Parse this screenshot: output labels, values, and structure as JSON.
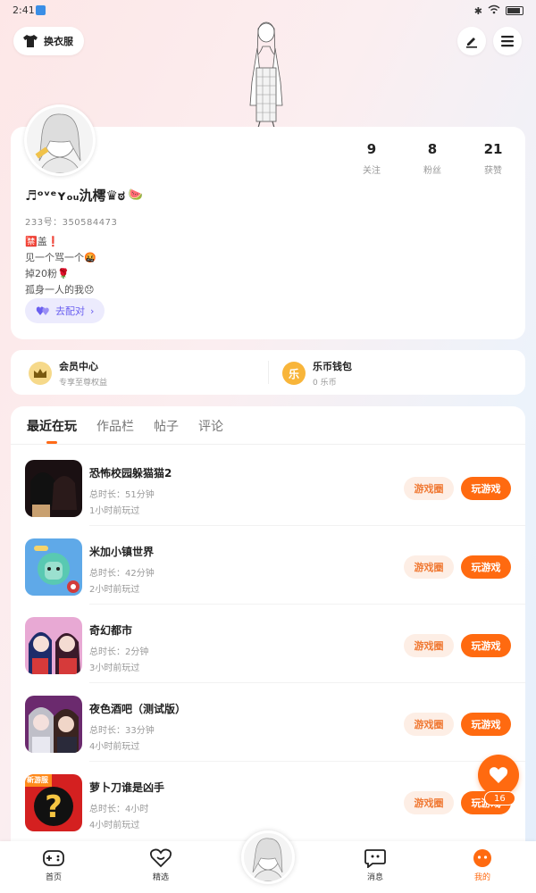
{
  "status_bar": {
    "time": "2:41"
  },
  "header": {
    "outfit_label": "换衣服"
  },
  "profile": {
    "stats": [
      {
        "num": "9",
        "label": "关注"
      },
      {
        "num": "8",
        "label": "粉丝"
      },
      {
        "num": "21",
        "label": "获赞"
      }
    ],
    "nickname": "♬ᵒᵛᵉʏₒᵤ氿樗♛ಠ",
    "uid": "233号：350584473",
    "bio": [
      "🈲盖❗",
      "见一个骂一个🤬",
      "掉20粉🌹",
      "孤身一人的我😞"
    ],
    "match_label": "去配对"
  },
  "member": {
    "vip_title": "会员中心",
    "vip_sub": "专享至尊权益",
    "wallet_title": "乐币钱包",
    "wallet_sub": "0 乐币",
    "wallet_glyph": "乐"
  },
  "tabs": [
    "最近在玩",
    "作品栏",
    "帖子",
    "评论"
  ],
  "games": [
    {
      "name": "恐怖校园躲猫猫2",
      "duration": "总时长：51分钟",
      "last": "1小时前玩过"
    },
    {
      "name": "米加小镇世界",
      "duration": "总时长：42分钟",
      "last": "2小时前玩过"
    },
    {
      "name": "奇幻都市",
      "duration": "总时长：2分钟",
      "last": "3小时前玩过"
    },
    {
      "name": "夜色酒吧（测试版）",
      "duration": "总时长：33分钟",
      "last": "4小时前玩过"
    },
    {
      "name": "萝卜刀谁是凶手",
      "duration": "总时长：4小时",
      "last": "4小时前玩过",
      "badge": "新游服"
    }
  ],
  "game_buttons": {
    "circle": "游戏圈",
    "play": "玩游戏"
  },
  "float_like": {
    "count": "16"
  },
  "bottom_nav": {
    "home": "首页",
    "featured": "精选",
    "messages": "消息",
    "mine": "我的"
  },
  "colors": {
    "accent": "#ff6a10",
    "match": "#6a5ff0"
  }
}
